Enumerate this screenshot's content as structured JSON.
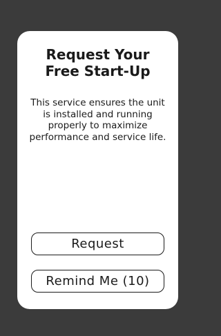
{
  "dialog": {
    "title_line1": "Request Your",
    "title_line2": "Free Start-Up",
    "description": "This service ensures the unit is installed and running properly to maximize performance and service life.",
    "request_label": "Request",
    "remind_label": "Remind Me (10)"
  },
  "colors": {
    "backdrop": "#3b3b3b",
    "card": "#ffffff",
    "text": "#1a1a1a"
  }
}
